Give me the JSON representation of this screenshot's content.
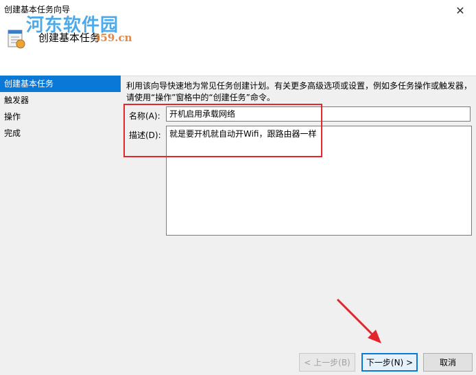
{
  "window": {
    "title": "创建基本任务向导",
    "close_glyph": "✕"
  },
  "header": {
    "title": "创建基本任务",
    "watermark_name": "河东软件园",
    "watermark_url": "359.cn"
  },
  "nav": {
    "items": [
      {
        "label": "创建基本任务",
        "active": true
      },
      {
        "label": "触发器",
        "active": false
      },
      {
        "label": "操作",
        "active": false
      },
      {
        "label": "完成",
        "active": false
      }
    ]
  },
  "main": {
    "description": "利用该向导快速地为常见任务创建计划。有关更多高级选项或设置，例如多任务操作或触发器，请使用“操作”窗格中的“创建任务”命令。",
    "name_label": "名称(A):",
    "name_value": "开机启用承载网络",
    "desc_label": "描述(D):",
    "desc_value": "就是要开机就自动开Wifi，跟路由器一样"
  },
  "buttons": {
    "back": "< 上一步(B)",
    "next": "下一步(N) >",
    "cancel": "取消"
  },
  "colors": {
    "accent": "#0a78d7",
    "annotation_red": "#e3262b"
  },
  "icons": [
    "task-scheduler-icon",
    "close-icon"
  ]
}
